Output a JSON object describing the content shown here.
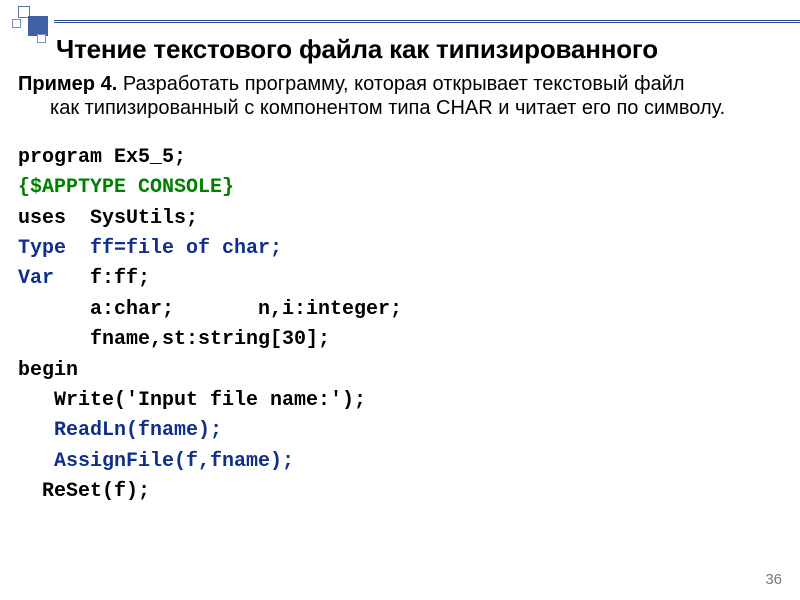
{
  "title": "Чтение текстового файла как типизированного",
  "example": {
    "lead": "Пример 4.",
    "text_first": " Разработать программу, которая открывает текстовый файл",
    "text_rest": "как типизированный с компонентом типа CHAR и читает его по символу."
  },
  "code": {
    "l1": "program Ex5_5;",
    "l2": "{$APPTYPE CONSOLE}",
    "l3": "uses  SysUtils;",
    "l4a": "Type  ",
    "l4b": "ff=file of char;",
    "l5a": "Var   ",
    "l5b": "f:ff;",
    "l6": "      a:char;       n,i:integer;",
    "l7": "      fname,st:string[30];",
    "l8": "begin",
    "l9": "   Write('Input file name:');",
    "l10": "   ReadLn(fname);",
    "l11": "   AssignFile(f,fname);",
    "l12": "  ReSet(f);"
  },
  "page_number": "36"
}
